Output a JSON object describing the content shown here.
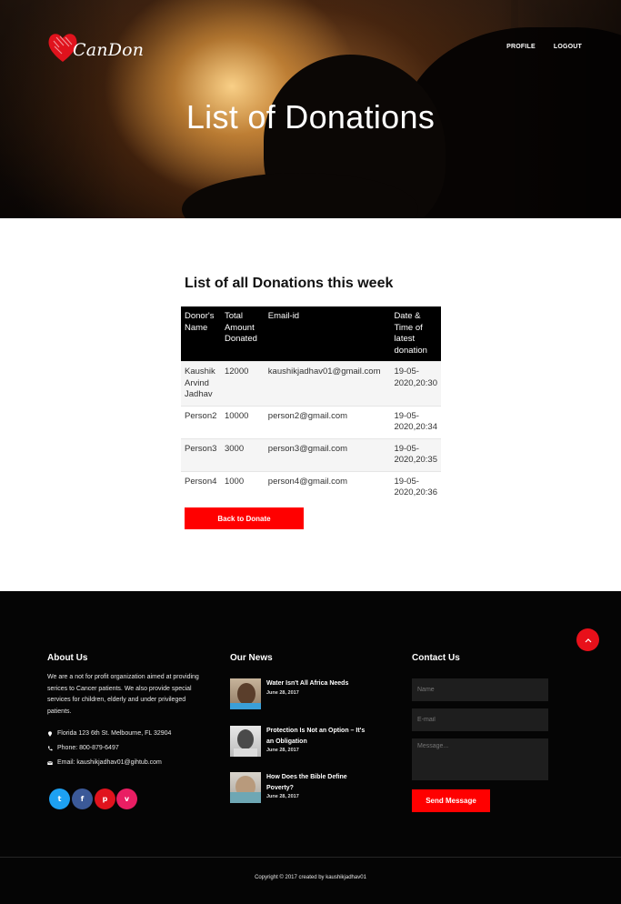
{
  "header": {
    "brand": "CanDon",
    "nav": [
      "PROFILE",
      "LOGOUT"
    ],
    "title": "List of Donations"
  },
  "main": {
    "section_title": "List of all Donations this week",
    "table": {
      "headers": [
        "Donor's Name",
        "Total Amount Donated",
        "Email-id",
        "Date & Time of latest donation"
      ],
      "rows": [
        [
          "Kaushik Arvind Jadhav",
          "12000",
          "kaushikjadhav01@gmail.com",
          "19-05-2020,20:30"
        ],
        [
          "Person2",
          "10000",
          "person2@gmail.com",
          "19-05-2020,20:34"
        ],
        [
          "Person3",
          "3000",
          "person3@gmail.com",
          "19-05-2020,20:35"
        ],
        [
          "Person4",
          "1000",
          "person4@gmail.com",
          "19-05-2020,20:36"
        ]
      ]
    },
    "back_button": "Back to Donate"
  },
  "footer": {
    "about": {
      "heading": "About Us",
      "text": "We are a not for profit organization aimed at providing serices to Cancer patients. We also provide special services for children, elderly and under privileged patients.",
      "address": "Florida 123 6th St. Melbourne, FL 32904",
      "phone": "Phone: 800-879-6497",
      "email": "Email: kaushikjadhav01@gihtub.com",
      "social": [
        {
          "icon": "twitter-icon",
          "glyph": "t",
          "color": "#1da1f2"
        },
        {
          "icon": "facebook-icon",
          "glyph": "f",
          "color": "#3b5998"
        },
        {
          "icon": "pinterest-icon",
          "glyph": "p",
          "color": "#e0131d"
        },
        {
          "icon": "vimeo-icon",
          "glyph": "v",
          "color": "#e91e63"
        }
      ]
    },
    "news": {
      "heading": "Our News",
      "items": [
        {
          "title": "Water Isn't All Africa Needs",
          "date": "June 28, 2017"
        },
        {
          "title": "Protection Is Not an Option – It's an Obligation",
          "date": "June 28, 2017"
        },
        {
          "title": "How Does the Bible Define Poverty?",
          "date": "June 28, 2017"
        }
      ]
    },
    "contact": {
      "heading": "Contact Us",
      "name_placeholder": "Name",
      "email_placeholder": "E-mail",
      "message_placeholder": "Message...",
      "send_label": "Send Message"
    },
    "copyright": "Copyright © 2017 created by kaushikjadhav01"
  },
  "colors": {
    "accent": "#ff0000",
    "footer_bg": "#050505",
    "table_header_bg": "#000000"
  }
}
